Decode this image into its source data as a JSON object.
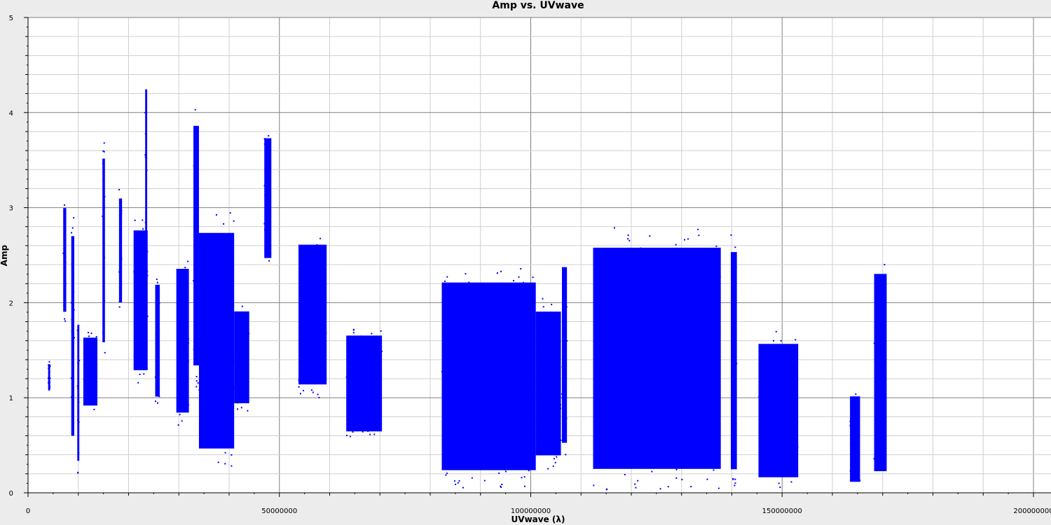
{
  "chart_data": {
    "type": "scatter",
    "title": "Amp vs. UVwave",
    "xlabel": "UVwave (λ)",
    "ylabel": "Amp",
    "xlim": [
      0,
      200000000
    ],
    "ylim": [
      0,
      5
    ],
    "x_ticks": [
      "0",
      "50000000",
      "100000000",
      "150000000",
      "200000000"
    ],
    "y_ticks": [
      "0",
      "1",
      "2",
      "3",
      "4",
      "5"
    ],
    "grid": true,
    "marker_color": "#0000ff",
    "clusters": [
      {
        "x": [
          4000000,
          4400000
        ],
        "y": [
          1.05,
          1.38
        ]
      },
      {
        "x": [
          7000000,
          7600000
        ],
        "y": [
          1.8,
          3.1
        ]
      },
      {
        "x": [
          8600000,
          9200000
        ],
        "y": [
          0.4,
          2.9
        ]
      },
      {
        "x": [
          9800000,
          10200000
        ],
        "y": [
          0.2,
          1.9
        ]
      },
      {
        "x": [
          11000000,
          13800000
        ],
        "y": [
          0.85,
          1.7
        ]
      },
      {
        "x": [
          14800000,
          15300000
        ],
        "y": [
          1.4,
          3.7
        ]
      },
      {
        "x": [
          18100000,
          18700000
        ],
        "y": [
          1.9,
          3.2
        ]
      },
      {
        "x": [
          21000000,
          23800000
        ],
        "y": [
          1.15,
          2.9
        ]
      },
      {
        "x": [
          23300000,
          23700000
        ],
        "y": [
          1.3,
          4.5
        ]
      },
      {
        "x": [
          25300000,
          26200000
        ],
        "y": [
          0.9,
          2.3
        ]
      },
      {
        "x": [
          29500000,
          32000000
        ],
        "y": [
          0.7,
          2.5
        ]
      },
      {
        "x": [
          32900000,
          34000000
        ],
        "y": [
          1.1,
          4.1
        ]
      },
      {
        "x": [
          34000000,
          41000000
        ],
        "y": [
          0.25,
          2.95
        ]
      },
      {
        "x": [
          41000000,
          44000000
        ],
        "y": [
          0.85,
          2.0
        ]
      },
      {
        "x": [
          47000000,
          48400000
        ],
        "y": [
          2.35,
          3.85
        ]
      },
      {
        "x": [
          53800000,
          59400000
        ],
        "y": [
          1.0,
          2.75
        ]
      },
      {
        "x": [
          63300000,
          70400000
        ],
        "y": [
          0.55,
          1.75
        ]
      },
      {
        "x": [
          82300000,
          101000000
        ],
        "y": [
          0.05,
          2.4
        ]
      },
      {
        "x": [
          101000000,
          106000000
        ],
        "y": [
          0.25,
          2.05
        ]
      },
      {
        "x": [
          106200000,
          107200000
        ],
        "y": [
          0.35,
          2.55
        ]
      },
      {
        "x": [
          112400000,
          137800000
        ],
        "y": [
          0.03,
          2.8
        ]
      },
      {
        "x": [
          139800000,
          141000000
        ],
        "y": [
          0.03,
          2.75
        ]
      },
      {
        "x": [
          145300000,
          153200000
        ],
        "y": [
          0.03,
          1.7
        ]
      },
      {
        "x": [
          163500000,
          165500000
        ],
        "y": [
          0.03,
          1.1
        ]
      },
      {
        "x": [
          168300000,
          170800000
        ],
        "y": [
          0.03,
          2.5
        ]
      }
    ]
  }
}
